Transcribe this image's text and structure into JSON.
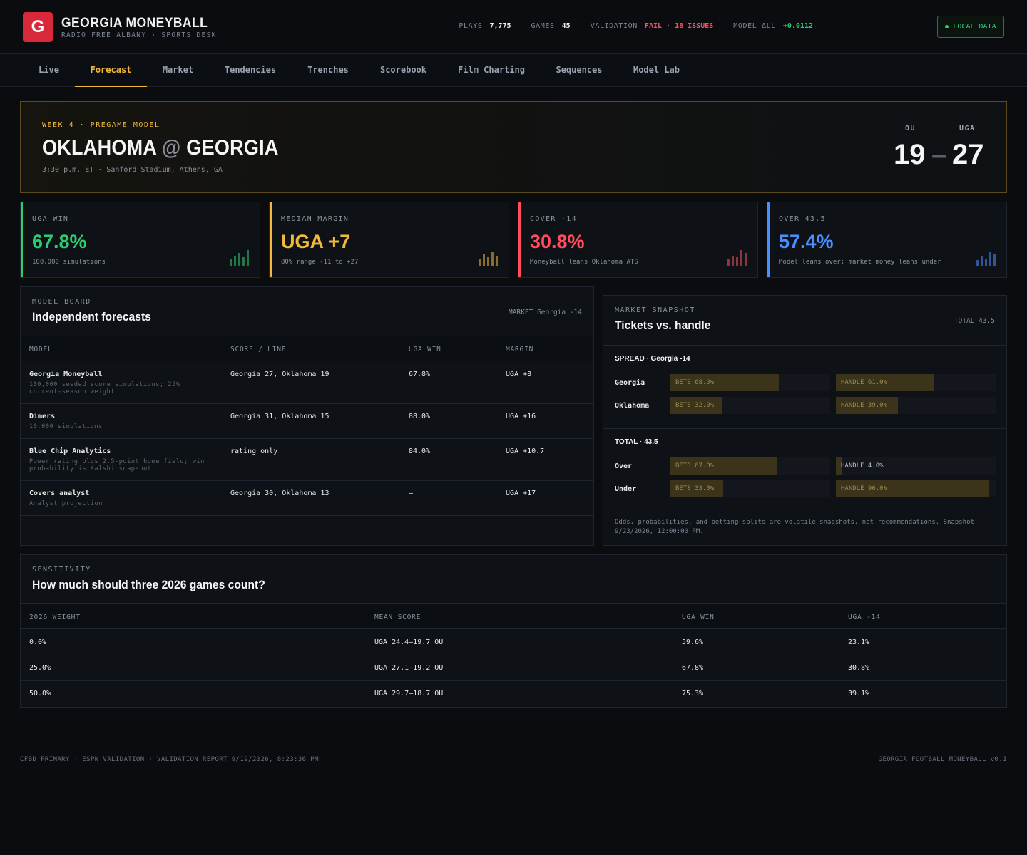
{
  "header": {
    "logo_letter": "G",
    "title": "GEORGIA MONEYBALL",
    "subtitle": "RADIO FREE ALBANY · SPORTS DESK",
    "stats": {
      "plays_label": "PLAYS",
      "plays": "7,775",
      "games_label": "GAMES",
      "games": "45",
      "validation_label": "VALIDATION",
      "validation": "FAIL · 18 ISSUES",
      "model_label": "MODEL ΔLL",
      "model": "+0.0112"
    },
    "local_data": "LOCAL DATA"
  },
  "tabs": [
    "Live",
    "Forecast",
    "Market",
    "Tendencies",
    "Trenches",
    "Scorebook",
    "Film Charting",
    "Sequences",
    "Model Lab"
  ],
  "active_tab": "Forecast",
  "game": {
    "eyebrow": "WEEK 4 · PREGAME MODEL",
    "away": "OKLAHOMA",
    "at": "@",
    "home": "GEORGIA",
    "meta": "3:30 p.m. ET · Sanford Stadium, Athens, GA",
    "away_abbr": "OU",
    "home_abbr": "UGA",
    "away_score": "19",
    "dash": "–",
    "home_score": "27"
  },
  "kpis": [
    {
      "label": "UGA WIN",
      "value": "67.8%",
      "sub": "100,000 simulations",
      "color": "#2ecc71"
    },
    {
      "label": "MEDIAN MARGIN",
      "value": "UGA +7",
      "sub": "80% range -11 to +27",
      "color": "#f0b93a"
    },
    {
      "label": "COVER -14",
      "value": "30.8%",
      "sub": "Moneyball leans Oklahoma ATS",
      "color": "#ff4d5e"
    },
    {
      "label": "OVER 43.5",
      "value": "57.4%",
      "sub": "Model leans over; market money leans under",
      "color": "#4a8fff"
    }
  ],
  "model_board": {
    "eyebrow": "MODEL BOARD",
    "title": "Independent forecasts",
    "market": "MARKET Georgia -14",
    "columns": [
      "MODEL",
      "SCORE / LINE",
      "UGA WIN",
      "MARGIN"
    ],
    "rows": [
      {
        "model": "Georgia Moneyball",
        "note": "100,000 seeded score simulations; 25% current-season weight",
        "score": "Georgia 27, Oklahoma 19",
        "win": "67.8%",
        "margin": "UGA +8"
      },
      {
        "model": "Dimers",
        "note": "10,000 simulations",
        "score": "Georgia 31, Oklahoma 15",
        "win": "88.0%",
        "margin": "UGA +16"
      },
      {
        "model": "Blue Chip Analytics",
        "note": "Power rating plus 2.5-point home field; win probability is Kalshi snapshot",
        "score": "rating only",
        "win": "84.0%",
        "margin": "UGA +10.7"
      },
      {
        "model": "Covers analyst",
        "note": "Analyst projection",
        "score": "Georgia 30, Oklahoma 13",
        "win": "—",
        "margin": "UGA +17"
      }
    ]
  },
  "market_snapshot": {
    "eyebrow": "MARKET SNAPSHOT",
    "title": "Tickets vs. handle",
    "total": "TOTAL 43.5",
    "spread_head": "SPREAD · Georgia -14",
    "spread": [
      {
        "team": "Georgia",
        "bets_label": "BETS 68.0%",
        "bets": 0.68,
        "handle_label": "HANDLE 61.0%",
        "handle": 0.61
      },
      {
        "team": "Oklahoma",
        "bets_label": "BETS 32.0%",
        "bets": 0.32,
        "handle_label": "HANDLE 39.0%",
        "handle": 0.39
      }
    ],
    "total_head": "TOTAL · 43.5",
    "totals": [
      {
        "team": "Over",
        "bets_label": "BETS 67.0%",
        "bets": 0.67,
        "handle_label": "HANDLE 4.0%",
        "handle": 0.04
      },
      {
        "team": "Under",
        "bets_label": "BETS 33.0%",
        "bets": 0.33,
        "handle_label": "HANDLE 96.0%",
        "handle": 0.96
      }
    ],
    "note": "Odds, probabilities, and betting splits are volatile snapshots, not recommendations. Snapshot 9/23/2026, 12:00:00 PM."
  },
  "sensitivity": {
    "eyebrow": "SENSITIVITY",
    "title": "How much should three 2026 games count?",
    "columns": [
      "2026 WEIGHT",
      "MEAN SCORE",
      "UGA WIN",
      "UGA -14"
    ],
    "rows": [
      {
        "weight": "0.0%",
        "mean": "UGA 24.4–19.7 OU",
        "win": "59.6%",
        "cover": "23.1%"
      },
      {
        "weight": "25.0%",
        "mean": "UGA 27.1–19.2 OU",
        "win": "67.8%",
        "cover": "30.8%"
      },
      {
        "weight": "50.0%",
        "mean": "UGA 29.7–18.7 OU",
        "win": "75.3%",
        "cover": "39.1%"
      }
    ]
  },
  "footer": {
    "left": "CFBD PRIMARY · ESPN VALIDATION · VALIDATION REPORT 9/19/2026, 8:23:36 PM",
    "right": "GEORGIA FOOTBALL MONEYBALL v0.1"
  }
}
